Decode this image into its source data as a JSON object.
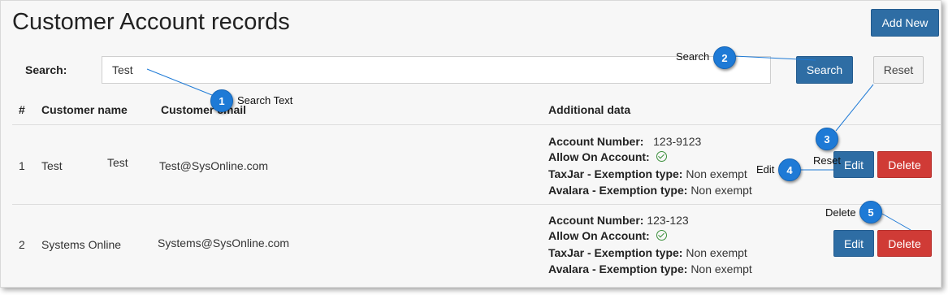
{
  "page": {
    "title": "Customer Account records",
    "add_new_label": "Add New"
  },
  "search": {
    "label": "Search:",
    "value": "Test",
    "search_button": "Search",
    "reset_button": "Reset"
  },
  "table": {
    "headers": [
      "#",
      "Customer name",
      "Customer email",
      "Additional data"
    ],
    "rows": [
      {
        "index": "1",
        "name": "Test",
        "name_extra": "Test",
        "email": "Test@SysOnline.com",
        "account_number_label": "Account Number:",
        "account_number": "123-9123",
        "allow_label": "Allow On Account:",
        "taxjar_label": "TaxJar - Exemption type:",
        "taxjar_value": "Non exempt",
        "avalara_label": "Avalara - Exemption type:",
        "avalara_value": "Non exempt",
        "edit_label": "Edit",
        "delete_label": "Delete"
      },
      {
        "index": "2",
        "name": "Systems Online",
        "email": "Systems@SysOnline.com",
        "account_number_label": "Account Number:",
        "account_number": "123-123",
        "allow_label": "Allow On Account:",
        "taxjar_label": "TaxJar - Exemption type:",
        "taxjar_value": "Non exempt",
        "avalara_label": "Avalara - Exemption type:",
        "avalara_value": "Non exempt",
        "edit_label": "Edit",
        "delete_label": "Delete"
      }
    ]
  },
  "callouts": [
    {
      "number": "1",
      "text": "Search Text"
    },
    {
      "number": "2",
      "text": "Search"
    },
    {
      "number": "3",
      "text": "Reset"
    },
    {
      "number": "4",
      "text": "Edit"
    },
    {
      "number": "5",
      "text": "Delete"
    }
  ],
  "colors": {
    "primary": "#2e6da4",
    "danger": "#d03b36",
    "callout": "#1e7ad6",
    "allowed_check": "#3a8f3a"
  }
}
